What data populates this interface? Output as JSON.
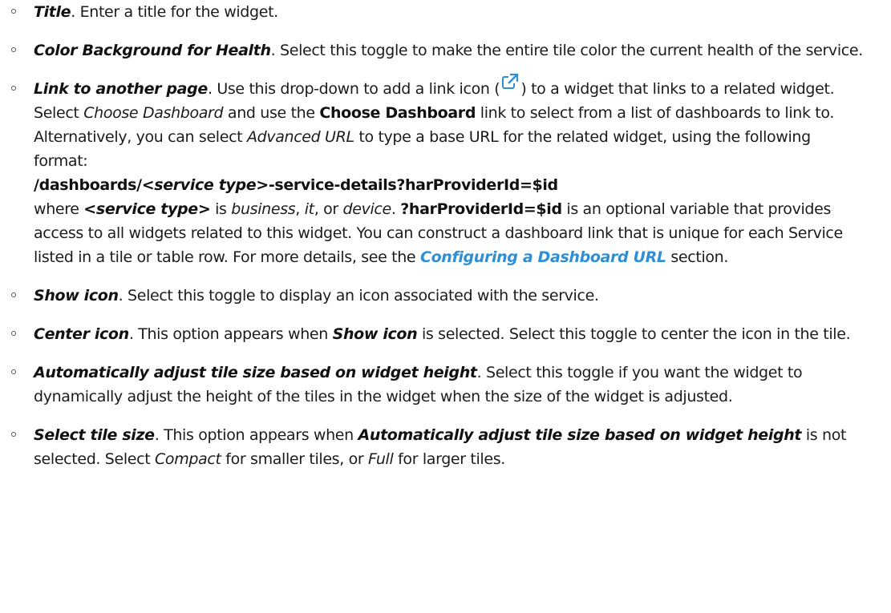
{
  "options": [
    {
      "term": "Title",
      "text": ". Enter a title for the widget."
    },
    {
      "term": "Color Background for Health",
      "text": ". Select this toggle to make the entire tile color the current health of the service."
    },
    {
      "term": "Link to another page",
      "text_a": ". Use this drop-down to add a link icon (",
      "icon": "external-link-icon",
      "text_b": ") to a widget that links to a related widget. Select ",
      "choose_dashboard_italic": "Choose Dashboard",
      "text_c": " and use the ",
      "choose_dashboard_bold": "Choose Dashboard",
      "text_d": " link to select from a list of dashboards to link to. Alternatively, you can select ",
      "advanced_url": "Advanced URL",
      "text_e": " to type a base URL for the related widget, using the following format:",
      "url_format_pre": "/dashboards/",
      "url_format_var": "<service type>",
      "url_format_post": "-service-details?harProviderId=$id",
      "where_pre": "where ",
      "where_var": "<service type>",
      "where_is": " is ",
      "type_business": "business",
      "comma1": ", ",
      "type_it": "it",
      "or": ", or ",
      "type_device": "device",
      "period": ". ",
      "variable": "?harProviderId=$id",
      "text_f": " is an optional variable that provides access to all widgets related to this widget. You can construct a dashboard link that is unique for each Service listed in a tile or table row. For more details, see the ",
      "link_text": "Configuring a Dashboard URL",
      "text_g": " section."
    },
    {
      "term": "Show icon",
      "text": ". Select this toggle to display an icon associated with the service."
    },
    {
      "term": "Center icon",
      "text_a": ". This option appears when ",
      "ref": "Show icon",
      "text_b": " is selected. Select this toggle to center the icon in the tile."
    },
    {
      "term": "Automatically adjust tile size based on widget height",
      "text": ". Select this toggle if you want the widget to dynamically adjust the height of the tiles in the widget when the size of the widget is adjusted."
    },
    {
      "term": "Select tile size",
      "text_a": ". This option appears when ",
      "ref": "Automatically adjust tile size based on widget height",
      "text_b": " is not selected. Select ",
      "compact": "Compact",
      "text_c": " for smaller tiles, or ",
      "full": "Full",
      "text_d": " for larger tiles."
    }
  ],
  "colors": {
    "text": "#1b1b1b",
    "link": "#2e8fd6",
    "icon": "#2e8fd6"
  }
}
